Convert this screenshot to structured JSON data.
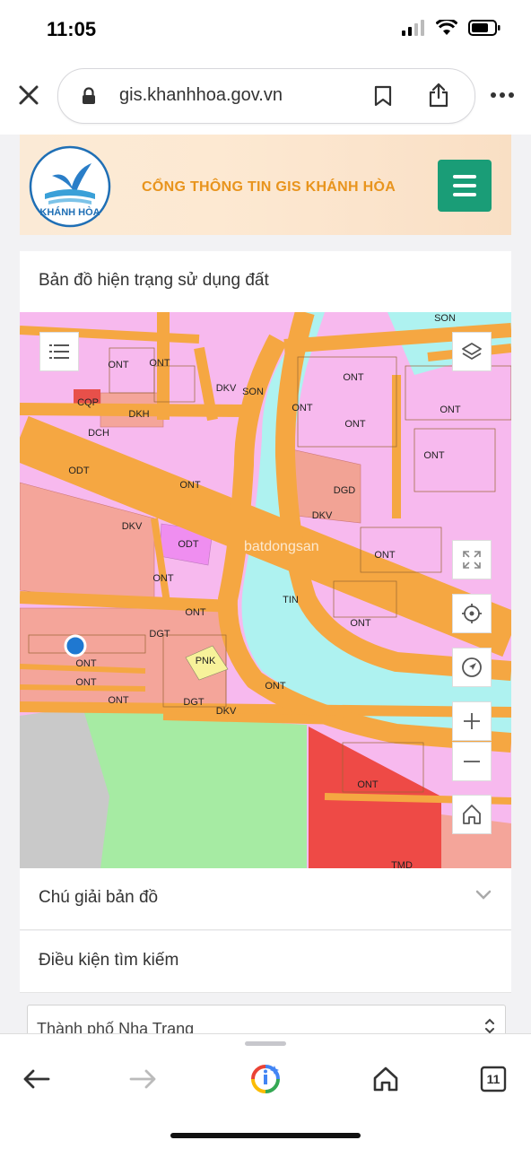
{
  "status": {
    "time": "11:05"
  },
  "browser": {
    "url": "gis.khanhhoa.gov.vn",
    "tab_count": "11"
  },
  "site": {
    "logo_text": "KHÁNH HÒA",
    "title": "CỔNG THÔNG TIN GIS KHÁNH HÒA"
  },
  "map_panel": {
    "title": "Bản đồ hiện trạng sử dụng đất"
  },
  "map": {
    "labels": [
      "ONT",
      "SON",
      "DGD",
      "DKV",
      "DCH",
      "DKH",
      "CQP",
      "ODT",
      "DGT",
      "PNK",
      "TIN",
      "TMD"
    ],
    "watermark": "batdongsan",
    "icons": [
      "list-icon",
      "layers-icon",
      "fullscreen-icon",
      "locate-icon",
      "navigate-icon",
      "zoom-in-icon",
      "zoom-out-icon",
      "home-icon"
    ]
  },
  "legend": {
    "title": "Chú giải bản đồ"
  },
  "search": {
    "title": "Điều kiện tìm kiếm",
    "city_select": "Thành phố Nha Trang"
  },
  "colors": {
    "accent": "#1a9d77",
    "title": "#e8941d",
    "road": "#f5a742",
    "river": "#aef2f0",
    "residential": "#f7b9ee"
  }
}
